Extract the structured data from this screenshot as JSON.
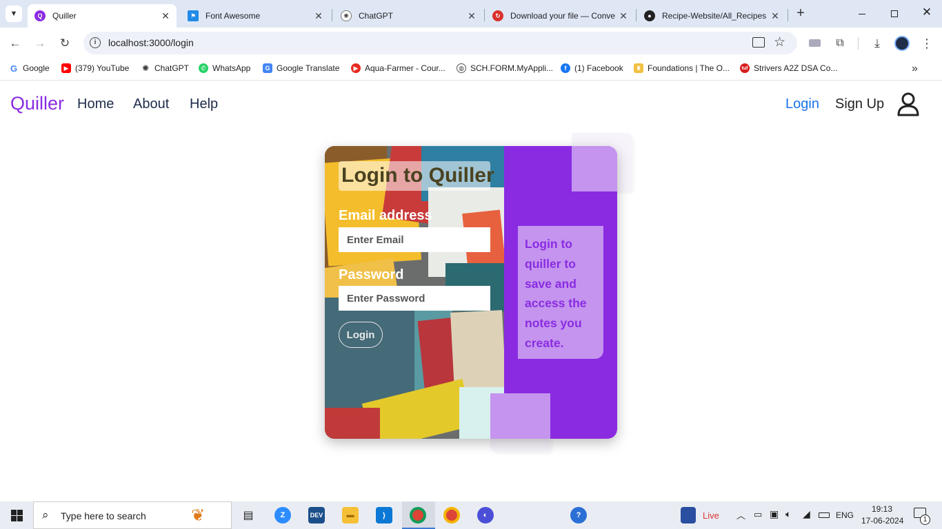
{
  "browser": {
    "tabs": [
      {
        "title": "Quiller",
        "icon": "quiller-favicon",
        "active": true
      },
      {
        "title": "Font Awesome",
        "icon": "font-awesome-favicon"
      },
      {
        "title": "ChatGPT",
        "icon": "chatgpt-favicon"
      },
      {
        "title": "Download your file — Conve",
        "icon": "convert-favicon"
      },
      {
        "title": "Recipe-Website/All_Recipes",
        "icon": "github-favicon"
      }
    ],
    "url": "localhost:3000/login",
    "bookmarks": [
      {
        "label": "Google",
        "icon": "google-icon"
      },
      {
        "label": "(379) YouTube",
        "icon": "youtube-icon"
      },
      {
        "label": "ChatGPT",
        "icon": "chatgpt-icon"
      },
      {
        "label": "WhatsApp",
        "icon": "whatsapp-icon"
      },
      {
        "label": "Google Translate",
        "icon": "google-translate-icon"
      },
      {
        "label": "Aqua-Farmer - Cour...",
        "icon": "aqua-farmer-icon"
      },
      {
        "label": "SCH.FORM.MyAppli...",
        "icon": "globe-icon"
      },
      {
        "label": "(1) Facebook",
        "icon": "facebook-icon"
      },
      {
        "label": "Foundations | The O...",
        "icon": "odin-icon"
      },
      {
        "label": "Strivers A2Z DSA Co...",
        "icon": "tuf-icon"
      }
    ]
  },
  "navbar": {
    "brand": "Quiller",
    "links": [
      "Home",
      "About",
      "Help"
    ],
    "login": "Login",
    "signup": "Sign Up",
    "user_icon": "user-icon"
  },
  "login_card": {
    "heading": "Login to Quiller",
    "email_label": "Email address",
    "email_placeholder": "Enter Email",
    "password_label": "Password",
    "password_placeholder": "Enter Password",
    "submit": "Login",
    "side_message": "Login to quiller to save and access the notes you create."
  },
  "taskbar": {
    "search_placeholder": "Type here to search",
    "live_label": "Live",
    "language": "ENG",
    "time": "19:13",
    "date": "17-06-2024",
    "notification_count": "1"
  },
  "colors": {
    "brand": "#8a2be2",
    "light_purple": "#c494ee",
    "login_link": "#1a73e8",
    "nav_text": "#1d2b4a"
  }
}
